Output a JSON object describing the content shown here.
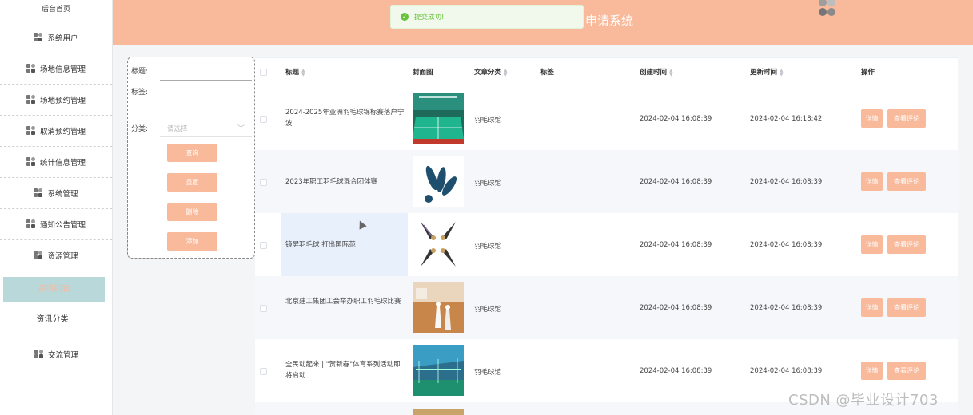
{
  "sidebar": {
    "home": "后台首页",
    "items": [
      {
        "label": "系统用户",
        "icon": "grid-icon"
      },
      {
        "label": "场地信息管理",
        "icon": "grid-icon"
      },
      {
        "label": "场地预约管理",
        "icon": "grid-icon"
      },
      {
        "label": "取消预约管理",
        "icon": "grid-icon"
      },
      {
        "label": "统计信息管理",
        "icon": "grid-icon"
      },
      {
        "label": "系统管理",
        "icon": "grid-icon"
      },
      {
        "label": "通知公告管理",
        "icon": "grid-icon"
      },
      {
        "label": "资源管理",
        "icon": "grid-icon"
      }
    ],
    "active": "资讯列表",
    "sub": "资讯分类",
    "last": {
      "label": "交流管理",
      "icon": "grid-icon"
    }
  },
  "header": {
    "title": "申请系统",
    "bg": "#f9b99b"
  },
  "toast": {
    "text": "提交成功!",
    "icon": "check-circle-icon"
  },
  "search": {
    "title_label": "标题:",
    "tag_label": "标签:",
    "category_label": "分类:",
    "category_placeholder": "请选择",
    "buttons": [
      "查询",
      "重置",
      "删除",
      "添加"
    ]
  },
  "table": {
    "headers": {
      "title": "标题",
      "cover": "封面图",
      "category": "文章分类",
      "tag": "标签",
      "created": "创建时间",
      "updated": "更新时间",
      "ops": "操作"
    },
    "rows": [
      {
        "title": "2024-2025年亚洲羽毛球锦标赛落户宁波",
        "category": "羽毛球馆",
        "tag": "",
        "created": "2024-02-04 16:08:39",
        "updated": "2024-02-04 16:18:42",
        "cover": "court"
      },
      {
        "title": "2023年职工羽毛球混合团体赛",
        "category": "羽毛球馆",
        "tag": "",
        "created": "2024-02-04 16:08:39",
        "updated": "2024-02-04 16:08:39",
        "cover": "logo"
      },
      {
        "title": "镜屏羽毛球 打出国际范",
        "category": "羽毛球馆",
        "tag": "",
        "created": "2024-02-04 16:08:39",
        "updated": "2024-02-04 16:08:39",
        "cover": "shuttles"
      },
      {
        "title": "北京建工集团工会举办职工羽毛球比赛",
        "category": "羽毛球馆",
        "tag": "",
        "created": "2024-02-04 16:08:39",
        "updated": "2024-02-04 16:08:39",
        "cover": "floor"
      },
      {
        "title": "全民动起来 | \"贺新春\"体育系列活动即将启动",
        "category": "羽毛球馆",
        "tag": "",
        "created": "2024-02-04 16:08:39",
        "updated": "2024-02-04 16:08:39",
        "cover": "hall"
      }
    ],
    "detail_label": "详情",
    "comment_label": "查看评论"
  },
  "watermark": "CSDN @毕业设计703",
  "colors": {
    "accent": "#f9b99b",
    "active_bg": "#b9d8d9",
    "success": "#67c23a"
  }
}
